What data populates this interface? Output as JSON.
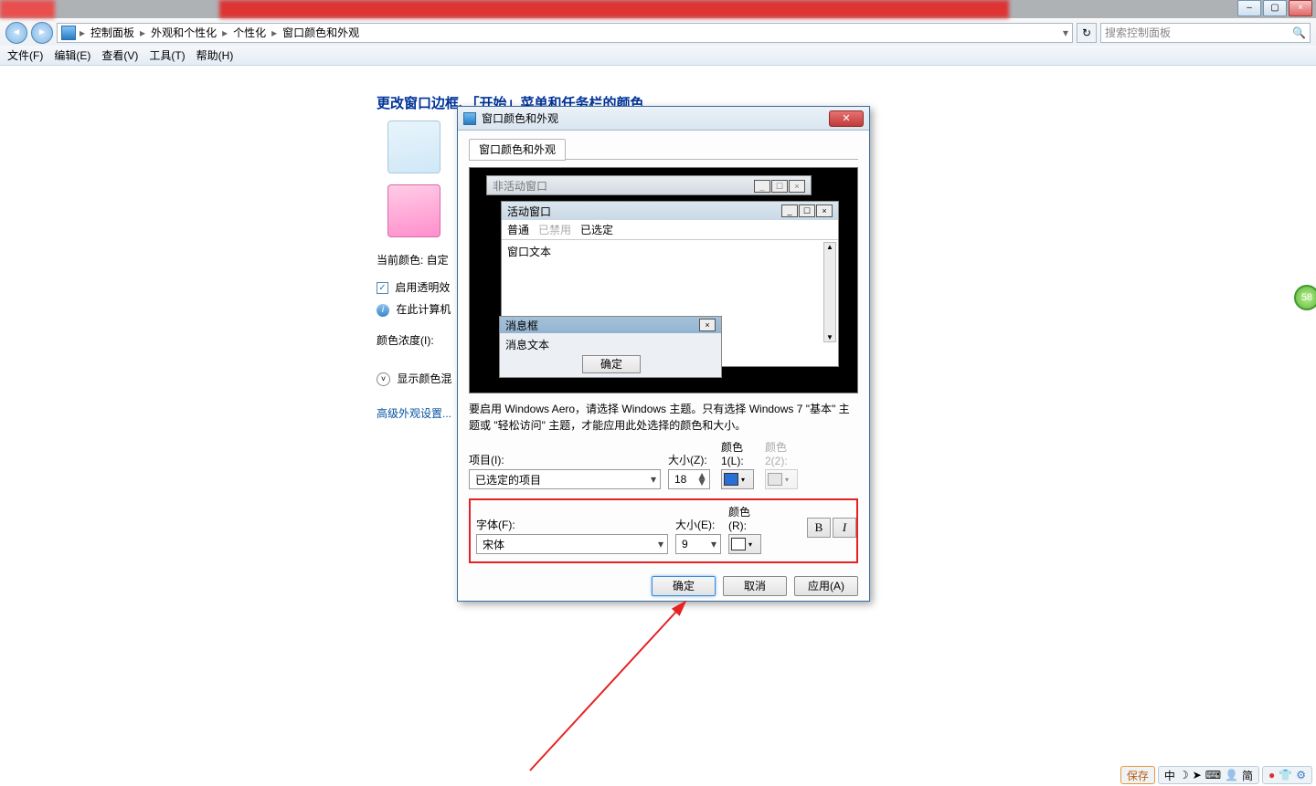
{
  "titlebar": {
    "min": "–",
    "max": "▢",
    "close": "×"
  },
  "nav": {
    "backArrow": "◄",
    "fwdArrow": "►",
    "sep": "▸",
    "crumbs": [
      "控制面板",
      "外观和个性化",
      "个性化",
      "窗口颜色和外观"
    ],
    "dropdown": "▾",
    "refreshIcon": "↻",
    "searchPlaceholder": "搜索控制面板",
    "magIcon": "🔍"
  },
  "menu": {
    "items": [
      "文件(F)",
      "编辑(E)",
      "查看(V)",
      "工具(T)",
      "帮助(H)"
    ]
  },
  "page": {
    "heading": "更改窗口边框、「开始」菜单和任务栏的颜色",
    "currentColorLabel": "当前颜色: 自定",
    "transparencyLabel": "启用透明效",
    "hardwareNote": "在此计算机",
    "intensityLabel": "颜色浓度(I):",
    "expanderLabel": "显示颜色混",
    "advancedLink": "高级外观设置..."
  },
  "dialog": {
    "title": "窗口颜色和外观",
    "closeX": "✕",
    "tabLabel": "窗口颜色和外观",
    "preview": {
      "inactiveTitle": "非活动窗口",
      "activeTitle": "活动窗口",
      "menuNormal": "普通",
      "menuDisabled": "已禁用",
      "menuSelected": "已选定",
      "windowText": "窗口文本",
      "msgTitle": "消息框",
      "msgText": "消息文本",
      "msgOk": "确定"
    },
    "note": "要启用 Windows Aero，请选择 Windows 主题。只有选择 Windows 7 \"基本\" 主题或 \"轻松访问\" 主题，才能应用此处选择的颜色和大小。",
    "row1": {
      "itemLabel": "项目(I):",
      "itemValue": "已选定的项目",
      "sizeLabel": "大小(Z):",
      "sizeValue": "18",
      "color1Label": "颜色 1(L):",
      "color1": "#2a6fd6",
      "color2Label": "颜色 2(2):",
      "color2": "#cccccc"
    },
    "row2": {
      "fontLabel": "字体(F):",
      "fontValue": "宋体",
      "sizeLabel": "大小(E):",
      "sizeValue": "9",
      "colorLabel": "颜色(R):",
      "color": "#ffffff"
    },
    "bold": "B",
    "italic": "I",
    "ok": "确定",
    "cancel": "取消",
    "apply": "应用(A)"
  },
  "tray": {
    "save": "保存",
    "cn": "中",
    "moon": "☽",
    "arrow": "➤",
    "grid": "⌨",
    "user": "👤",
    "jian": "简",
    "rec": "●",
    "shirt": "👕",
    "gear": "⚙"
  },
  "badge": "58"
}
